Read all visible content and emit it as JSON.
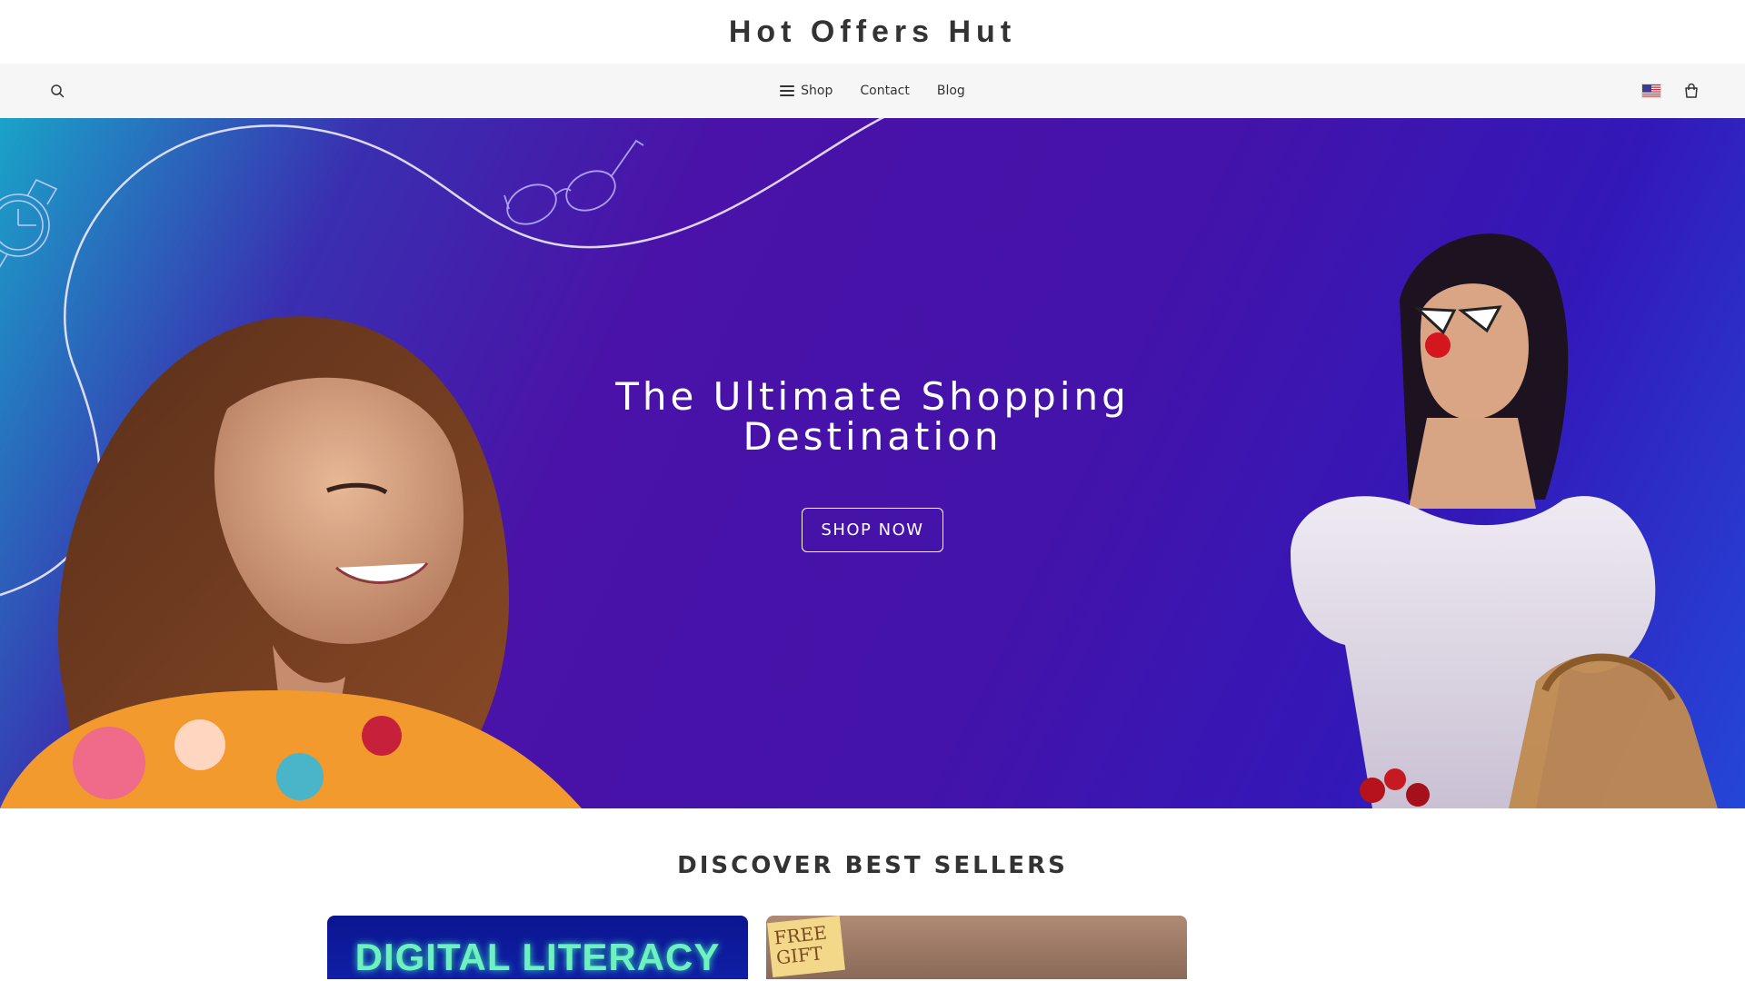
{
  "store": {
    "name": "Hot Offers Hut"
  },
  "nav": {
    "items": [
      {
        "label": "Shop"
      },
      {
        "label": "Contact"
      },
      {
        "label": "Blog"
      }
    ]
  },
  "hero": {
    "title_line1": "The Ultimate Shopping",
    "title_line2": "Destination",
    "cta_label": "SHOP NOW"
  },
  "best_sellers": {
    "title": "DISCOVER BEST SELLERS",
    "cards": [
      {
        "image_text": "DIGITAL LITERACY"
      },
      {
        "image_text": "FREE GIFT"
      }
    ]
  },
  "colors": {
    "hero_purple": "#4313aa",
    "hero_blue": "#2447d8",
    "nav_bg": "#f6f6f6"
  },
  "icons": [
    "search-icon",
    "menu-icon",
    "us-flag-icon",
    "shopping-bag-icon"
  ]
}
